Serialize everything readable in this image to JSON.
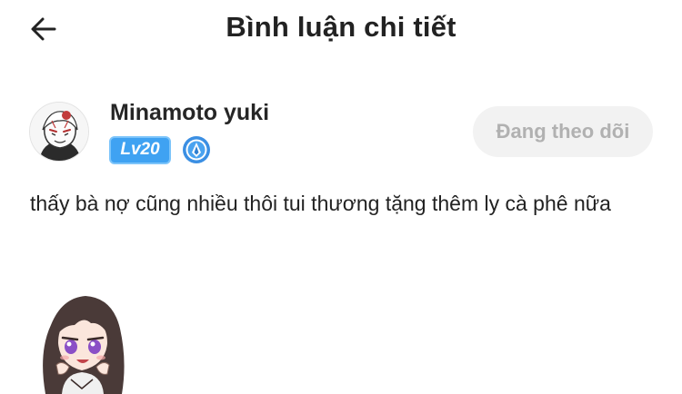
{
  "header": {
    "title": "Bình luận chi tiết",
    "back_icon": "arrow-left-icon"
  },
  "comment": {
    "username": "Minamoto yuki",
    "level": "Lv20",
    "rank_icon": "rank-emblem-icon",
    "follow_label": "Đang theo dõi",
    "text": "thấy bà nợ cũng nhiều thôi tui thương tặng thêm ly cà phê nữa",
    "sticker": "anime-girl-sticker"
  },
  "colors": {
    "level_badge": "#3fa2f2",
    "follow_bg": "#f2f2f2",
    "follow_text": "#b1b1b1",
    "text": "#222222"
  }
}
